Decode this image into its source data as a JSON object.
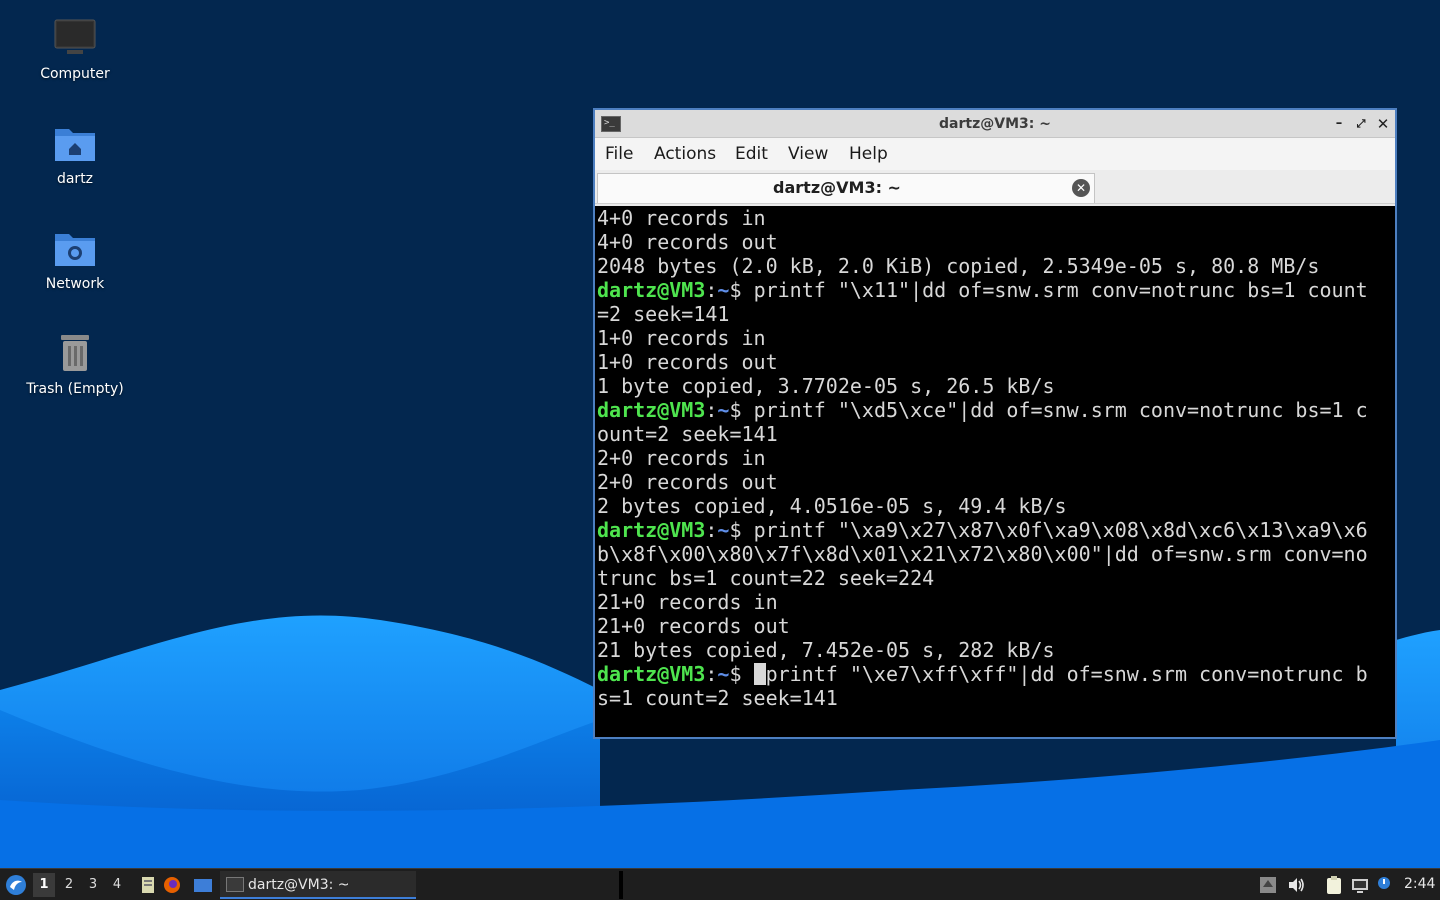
{
  "desktop": {
    "icons": [
      {
        "label": "Computer",
        "icon": "computer-icon"
      },
      {
        "label": "dartz",
        "icon": "home-folder-icon"
      },
      {
        "label": "Network",
        "icon": "network-folder-icon"
      },
      {
        "label": "Trash (Empty)",
        "icon": "trash-icon"
      }
    ]
  },
  "window": {
    "title": "dartz@VM3: ~",
    "menu": [
      "File",
      "Actions",
      "Edit",
      "View",
      "Help"
    ],
    "tab_label": "dartz@VM3: ~",
    "prompt_user": "dartz@VM3",
    "prompt_sep": ":",
    "prompt_tilde": "~",
    "prompt_dollar": "$ ",
    "terminal_lines": [
      {
        "text": "4+0 records in"
      },
      {
        "text": "4+0 records out"
      },
      {
        "text": "2048 bytes (2.0 kB, 2.0 KiB) copied, 2.5349e-05 s, 80.8 MB/s"
      },
      {
        "prompt": true,
        "text": "printf \"\\x11\"|dd of=snw.srm conv=notrunc bs=1 count"
      },
      {
        "text": "=2 seek=141"
      },
      {
        "text": "1+0 records in"
      },
      {
        "text": "1+0 records out"
      },
      {
        "text": "1 byte copied, 3.7702e-05 s, 26.5 kB/s"
      },
      {
        "prompt": true,
        "text": "printf \"\\xd5\\xce\"|dd of=snw.srm conv=notrunc bs=1 c"
      },
      {
        "text": "ount=2 seek=141"
      },
      {
        "text": "2+0 records in"
      },
      {
        "text": "2+0 records out"
      },
      {
        "text": "2 bytes copied, 4.0516e-05 s, 49.4 kB/s"
      },
      {
        "prompt": true,
        "text": "printf \"\\xa9\\x27\\x87\\x0f\\xa9\\x08\\x8d\\xc6\\x13\\xa9\\x6"
      },
      {
        "text": "b\\x8f\\x00\\x80\\x7f\\x8d\\x01\\x21\\x72\\x80\\x00\"|dd of=snw.srm conv=no"
      },
      {
        "text": "trunc bs=1 count=22 seek=224"
      },
      {
        "text": "21+0 records in"
      },
      {
        "text": "21+0 records out"
      },
      {
        "text": "21 bytes copied, 7.452e-05 s, 282 kB/s"
      },
      {
        "prompt": true,
        "cursor": true,
        "text": "printf \"\\xe7\\xff\\xff\"|dd of=snw.srm conv=notrunc b"
      },
      {
        "text": "s=1 count=2 seek=141"
      }
    ]
  },
  "taskbar": {
    "workspaces": [
      "1",
      "2",
      "3",
      "4"
    ],
    "active_workspace": "1",
    "task_label": "dartz@VM3: ~",
    "clock": "2:44"
  },
  "colors": {
    "desktop_bg": "#03274f",
    "wave_light": "#1e90ff",
    "prompt_user": "#4ee44e",
    "prompt_path": "#5f8ee8",
    "taskbar_bg": "#1e1e1e"
  }
}
